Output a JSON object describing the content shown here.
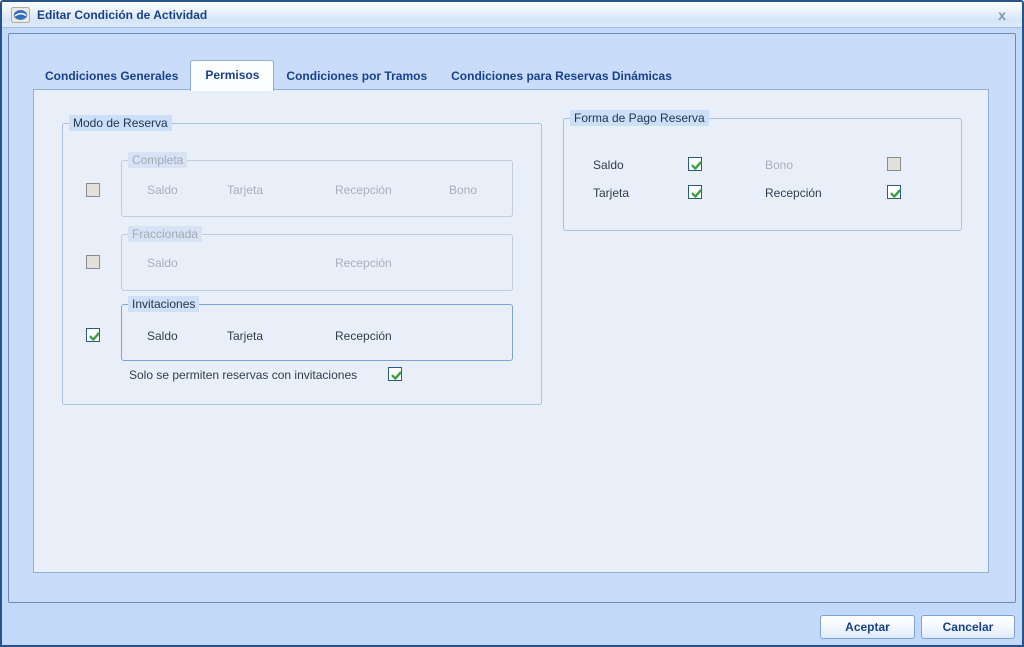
{
  "window": {
    "title": "Editar Condición de Actividad",
    "close_glyph": "x"
  },
  "tabs": [
    {
      "label": "Condiciones Generales",
      "active": false
    },
    {
      "label": "Permisos",
      "active": true
    },
    {
      "label": "Condiciones por Tramos",
      "active": false
    },
    {
      "label": "Condiciones para Reservas Dinámicas",
      "active": false
    }
  ],
  "permisos_page": {
    "modo_de_reserva": {
      "title": "Modo de Reserva",
      "modes": [
        {
          "name": "Completa",
          "enabled": false,
          "selected": false,
          "options": [
            "Saldo",
            "Tarjeta",
            "Recepción",
            "Bono"
          ]
        },
        {
          "name": "Fraccionada",
          "enabled": false,
          "selected": false,
          "options": [
            "Saldo",
            "Recepción"
          ]
        },
        {
          "name": "Invitaciones",
          "enabled": true,
          "selected": true,
          "options": [
            "Saldo",
            "Tarjeta",
            "Recepción"
          ]
        }
      ],
      "only_invitations": {
        "label": "Solo se permiten reservas con invitaciones",
        "checked": true
      }
    },
    "forma_de_pago_reserva": {
      "title": "Forma de Pago Reserva",
      "options": [
        {
          "label": "Saldo",
          "checked": true,
          "enabled": true
        },
        {
          "label": "Bono",
          "checked": false,
          "enabled": false
        },
        {
          "label": "Tarjeta",
          "checked": true,
          "enabled": true
        },
        {
          "label": "Recepción",
          "checked": true,
          "enabled": true
        }
      ]
    }
  },
  "footer": {
    "accept_label": "Aceptar",
    "cancel_label": "Cancelar"
  },
  "colors": {
    "accent_text": "#17418a",
    "window_border": "#27538c",
    "content_bg": "#c3d9fa",
    "page_bg": "#e9eff9",
    "label_highlight": "#cbdff7",
    "check_green": "#3aa03f",
    "disabled_text": "#a8afba"
  }
}
